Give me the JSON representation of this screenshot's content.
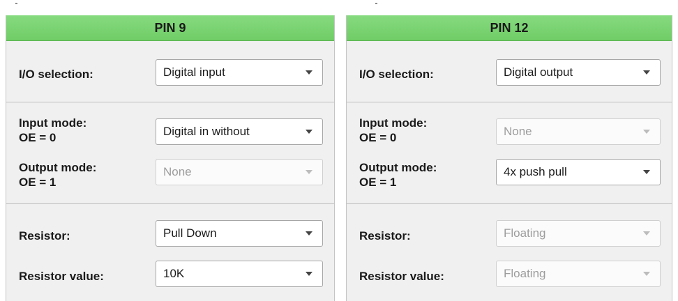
{
  "panels": [
    {
      "title": "PIN 9",
      "io_label": "I/O selection:",
      "io_value": "Digital input",
      "input_mode_label_1": "Input mode:",
      "input_mode_label_2": "OE = 0",
      "input_mode_value": "Digital in without",
      "output_mode_label_1": "Output mode:",
      "output_mode_label_2": "OE = 1",
      "output_mode_value": "None",
      "resistor_label": "Resistor:",
      "resistor_value": "Pull Down",
      "resistor_value_label": "Resistor value:",
      "resistor_value_value": "10K"
    },
    {
      "title": "PIN 12",
      "io_label": "I/O selection:",
      "io_value": "Digital output",
      "input_mode_label_1": "Input mode:",
      "input_mode_label_2": "OE = 0",
      "input_mode_value": "None",
      "output_mode_label_1": "Output mode:",
      "output_mode_label_2": "OE = 1",
      "output_mode_value": "4x push pull",
      "resistor_label": "Resistor:",
      "resistor_value": "Floating",
      "resistor_value_label": "Resistor value:",
      "resistor_value_value": "Floating"
    }
  ],
  "colors": {
    "header_green": "#75d06b",
    "disabled_text": "#9d9d9d"
  },
  "icons": {
    "dropdown": "chevron-down-icon"
  }
}
